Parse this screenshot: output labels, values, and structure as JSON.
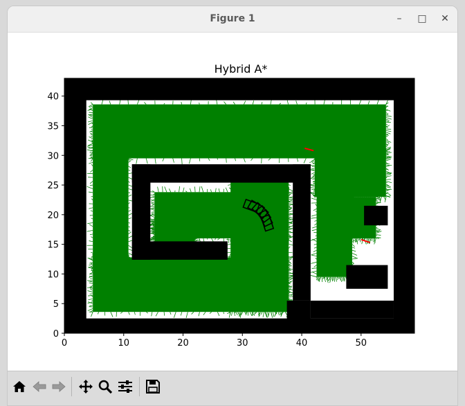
{
  "window": {
    "title": "Figure 1",
    "controls": {
      "minimize": "–",
      "maximize": "□",
      "close": "✕"
    }
  },
  "chart_data": {
    "type": "scatter",
    "title": "Hybrid A*",
    "xlabel": "",
    "ylabel": "",
    "xlim": [
      0,
      59
    ],
    "ylim": [
      0,
      43
    ],
    "xticks": [
      0,
      10,
      20,
      30,
      40,
      50
    ],
    "yticks": [
      0,
      5,
      10,
      15,
      20,
      25,
      30,
      35,
      40
    ],
    "grid": false,
    "obstacle_color": "#000000",
    "explored_color": "#008000",
    "path_color": "#ff0000",
    "vehicle_color": "#000000",
    "obstacles": [
      {
        "x0": 0,
        "y0": 0,
        "x1": 59,
        "y1": 2.5
      },
      {
        "x0": 0,
        "y0": 39.3,
        "x1": 59,
        "y1": 43
      },
      {
        "x0": 0,
        "y0": 0,
        "x1": 3.7,
        "y1": 43
      },
      {
        "x0": 55.5,
        "y0": 0,
        "x1": 59,
        "y1": 43
      },
      {
        "x0": 37.5,
        "y0": 0,
        "x1": 41.5,
        "y1": 5.5
      },
      {
        "x0": 41.5,
        "y0": 2.5,
        "x1": 55.5,
        "y1": 5.5
      },
      {
        "x0": 11.4,
        "y0": 25.4,
        "x1": 41.5,
        "y1": 28.5
      },
      {
        "x0": 38.5,
        "y0": 5.5,
        "x1": 41.5,
        "y1": 28.5
      },
      {
        "x0": 11.4,
        "y0": 12.4,
        "x1": 14.5,
        "y1": 28.5
      },
      {
        "x0": 11.4,
        "y0": 12.4,
        "x1": 27.5,
        "y1": 15.5
      },
      {
        "x0": 50.5,
        "y0": 18.2,
        "x1": 54.5,
        "y1": 21.5
      },
      {
        "x0": 47.5,
        "y0": 7.5,
        "x1": 54.5,
        "y1": 11.5
      }
    ],
    "explored_regions": [
      {
        "x0": 4.8,
        "y0": 3.6,
        "x1": 37.8,
        "y1": 12.8
      },
      {
        "x0": 4.8,
        "y0": 11,
        "x1": 10.8,
        "y1": 32
      },
      {
        "x0": 4.8,
        "y0": 29.5,
        "x1": 54.2,
        "y1": 38.6
      },
      {
        "x0": 42.2,
        "y0": 23,
        "x1": 54.2,
        "y1": 31
      },
      {
        "x0": 42.5,
        "y0": 9.5,
        "x1": 48.5,
        "y1": 26
      },
      {
        "x0": 46,
        "y0": 16,
        "x1": 52.5,
        "y1": 23
      },
      {
        "x0": 28,
        "y0": 3.6,
        "x1": 37.8,
        "y1": 27.2
      },
      {
        "x0": 15.2,
        "y0": 16,
        "x1": 37.8,
        "y1": 23.8
      },
      {
        "x0": 15.2,
        "y0": 14.8,
        "x1": 22,
        "y1": 19
      }
    ],
    "path_segments": [
      {
        "x": [
          40.5,
          42.0
        ],
        "y": [
          31.2,
          30.8
        ]
      },
      {
        "x": [
          50.0,
          51.5
        ],
        "y": [
          15.8,
          15.3
        ]
      }
    ],
    "vehicle_poses": [
      {
        "x": 31.5,
        "y": 21.5,
        "yaw_deg": -20
      },
      {
        "x": 32.3,
        "y": 21.2,
        "yaw_deg": -30
      },
      {
        "x": 33.0,
        "y": 20.7,
        "yaw_deg": -42
      },
      {
        "x": 33.5,
        "y": 20.1,
        "yaw_deg": -54
      },
      {
        "x": 33.9,
        "y": 19.4,
        "yaw_deg": -64
      },
      {
        "x": 34.2,
        "y": 18.6,
        "yaw_deg": -72
      }
    ]
  },
  "toolbar": {
    "buttons": [
      {
        "name": "home-button",
        "icon": "home-icon",
        "tooltip": "Reset original view"
      },
      {
        "name": "back-button",
        "icon": "back-arrow-icon",
        "tooltip": "Back to previous view"
      },
      {
        "name": "forward-button",
        "icon": "forward-arrow-icon",
        "tooltip": "Forward to next view"
      },
      {
        "name": "pan-button",
        "icon": "pan-move-icon",
        "tooltip": "Pan axes"
      },
      {
        "name": "zoom-button",
        "icon": "zoom-magnifier-icon",
        "tooltip": "Zoom to rectangle"
      },
      {
        "name": "configure-subplots-button",
        "icon": "sliders-icon",
        "tooltip": "Configure subplots"
      },
      {
        "name": "save-button",
        "icon": "floppy-disk-icon",
        "tooltip": "Save the figure"
      }
    ]
  }
}
